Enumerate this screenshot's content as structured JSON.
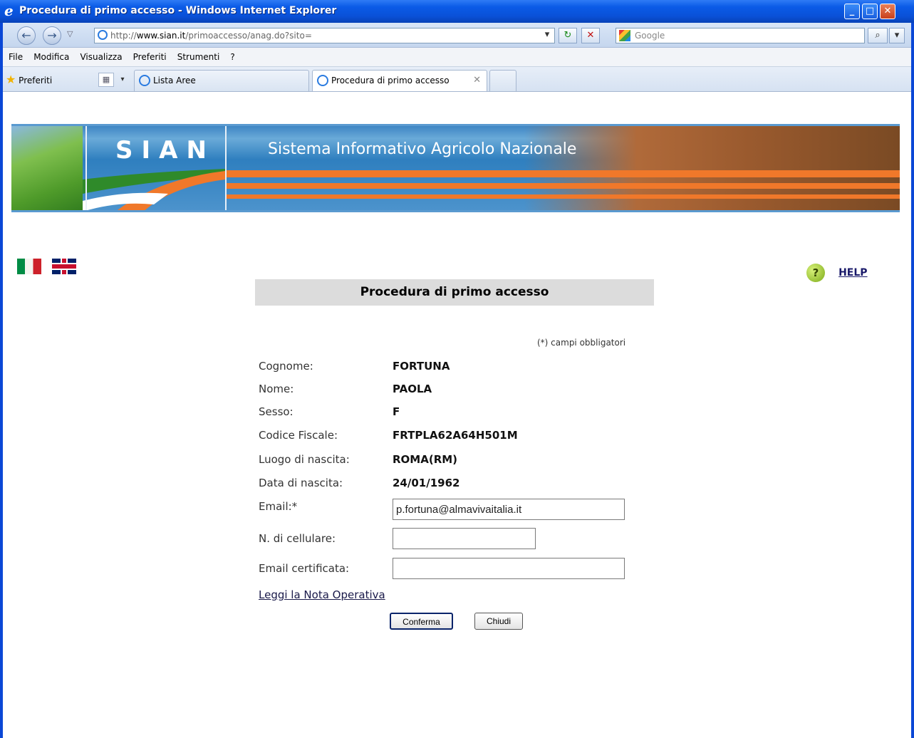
{
  "window": {
    "title": "Procedura di primo accesso - Windows Internet Explorer"
  },
  "address": {
    "url_scheme": "http://",
    "url_host": "www.sian.it",
    "url_path": "/primoaccesso/anag.do?sito=",
    "search_placeholder": "Google"
  },
  "menu": [
    "File",
    "Modifica",
    "Visualizza",
    "Preferiti",
    "Strumenti",
    "?"
  ],
  "favorites": {
    "label": "Preferiti"
  },
  "tabs": [
    {
      "label": "Lista Aree",
      "active": false
    },
    {
      "label": "Procedura di primo accesso",
      "active": true
    }
  ],
  "banner": {
    "logo": "SIAN",
    "subtitle": "Sistema Informativo Agricolo Nazionale"
  },
  "help": {
    "label": "HELP"
  },
  "form": {
    "heading": "Procedura di primo accesso",
    "required_note": "(*) campi obbligatori",
    "fields": [
      {
        "label": "Cognome:",
        "value": "FORTUNA"
      },
      {
        "label": "Nome:",
        "value": "PAOLA"
      },
      {
        "label": "Sesso:",
        "value": "F"
      },
      {
        "label": "Codice Fiscale:",
        "value": "FRTPLA62A64H501M"
      },
      {
        "label": "Luogo di nascita:",
        "value": "ROMA(RM)"
      },
      {
        "label": "Data di nascita:",
        "value": "24/01/1962"
      }
    ],
    "email": {
      "label": "Email:*",
      "value": "p.fortuna@almavivaitalia.it"
    },
    "cellulare": {
      "label": "N. di cellulare:",
      "value": ""
    },
    "pec": {
      "label": "Email certificata:",
      "value": ""
    },
    "nota_link": "Leggi la Nota Operativa",
    "confirm_label": "Conferma",
    "close_label": "Chiudi"
  },
  "colors": {
    "titlebar": "#0a51d8",
    "banner_orange": "#f0782a",
    "heading_bg": "#dcdcdc"
  }
}
